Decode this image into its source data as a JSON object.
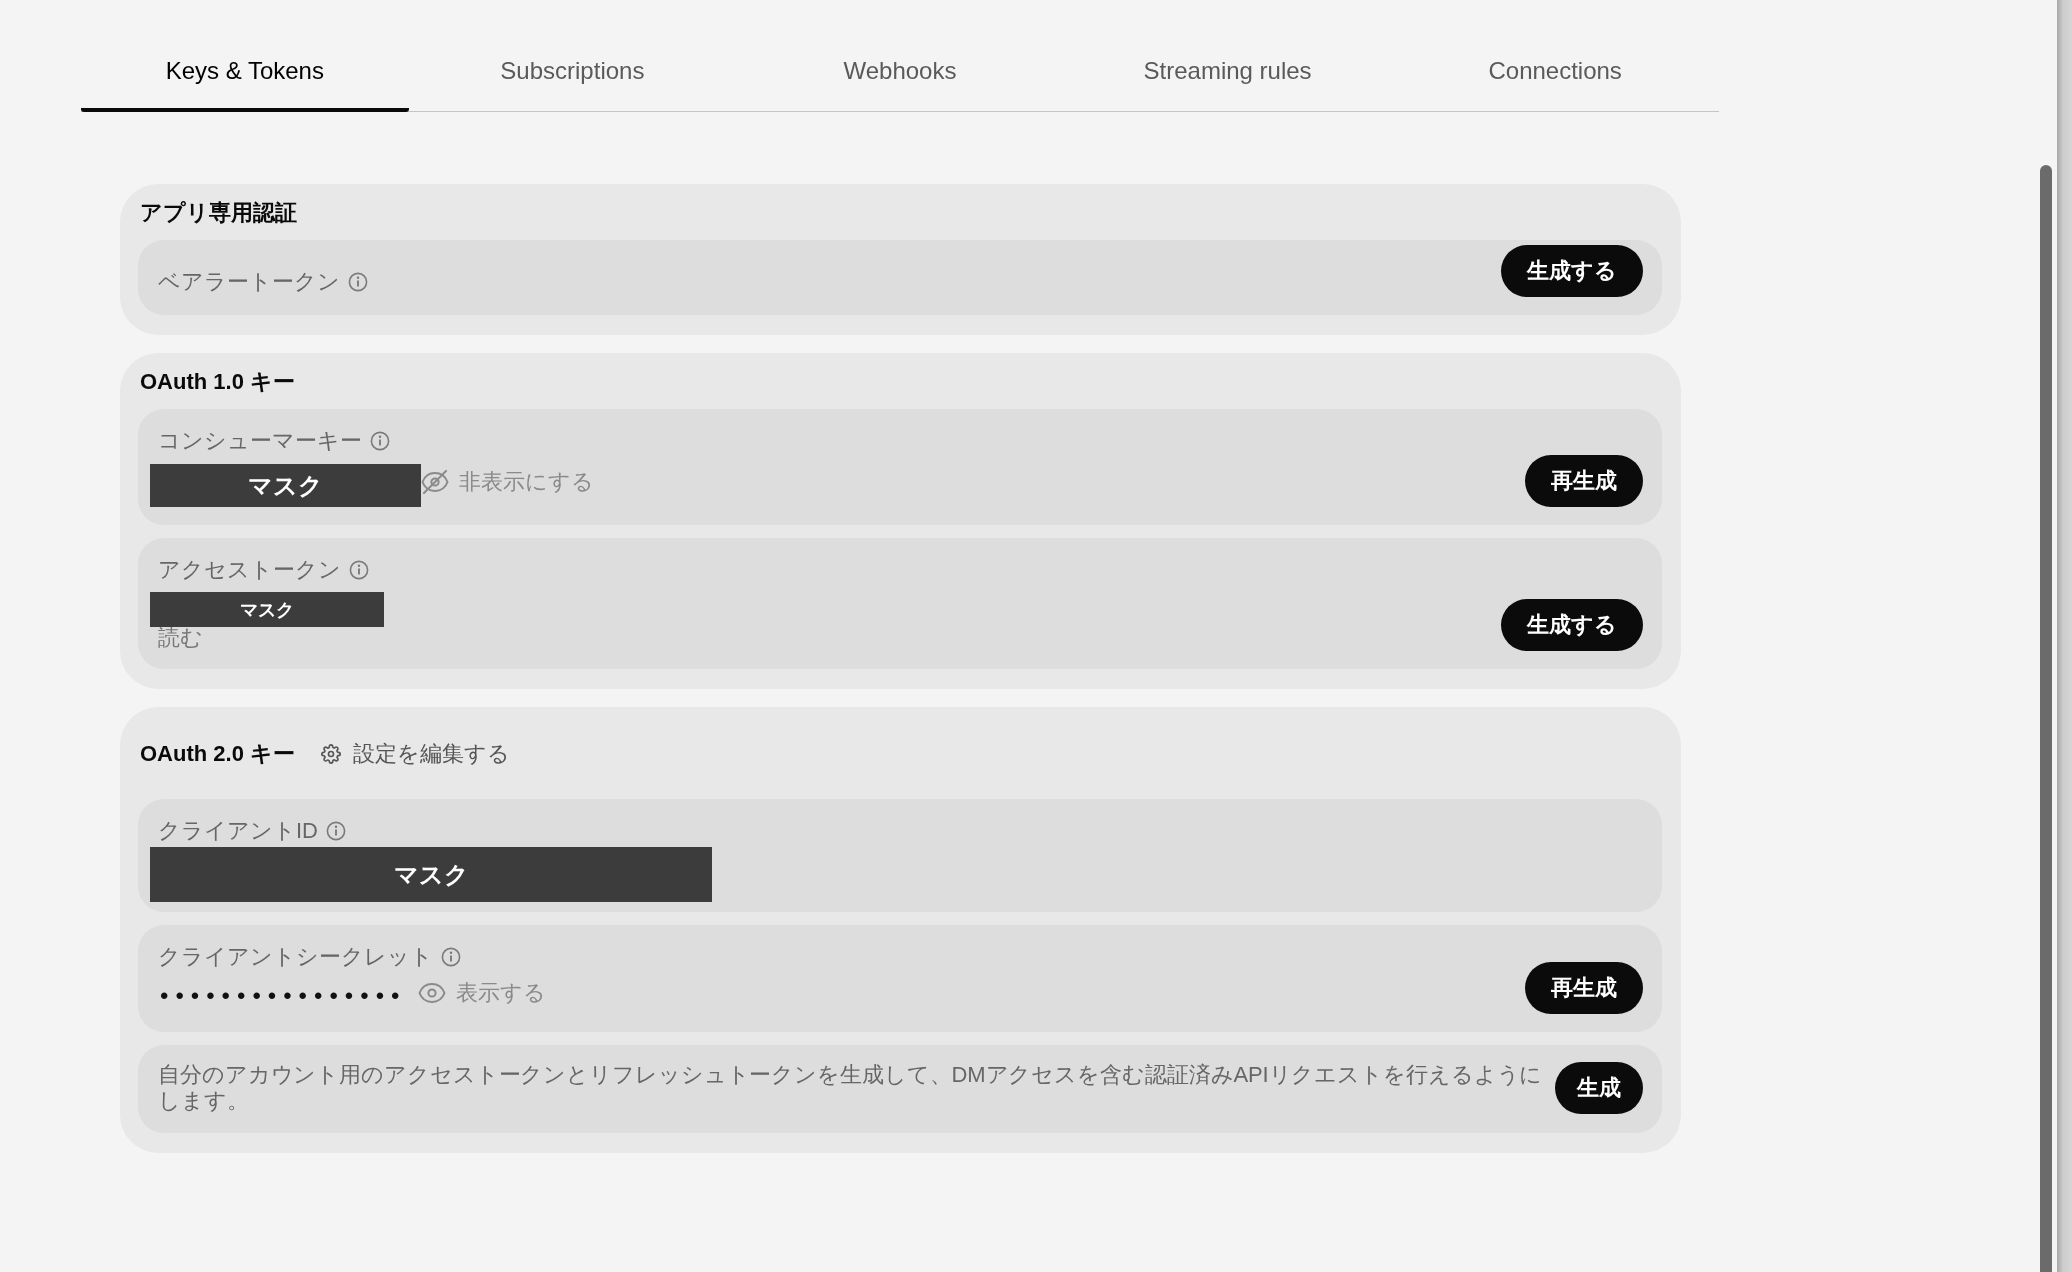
{
  "tabs": [
    {
      "label": "Keys & Tokens",
      "selected": true
    },
    {
      "label": "Subscriptions",
      "selected": false
    },
    {
      "label": "Webhooks",
      "selected": false
    },
    {
      "label": "Streaming rules",
      "selected": false
    },
    {
      "label": "Connections",
      "selected": false
    }
  ],
  "sections": [
    {
      "title": "アプリ専用認証",
      "rows": [
        {
          "kind": "credential",
          "label": "ベアラートークン",
          "button": "生成する"
        }
      ]
    },
    {
      "title": "OAuth 1.0 キー",
      "rows": [
        {
          "kind": "credential",
          "label": "コンシューマーキー",
          "mask": "マスク",
          "toggle": {
            "label": "非表示にする",
            "visible": true
          },
          "button": "再生成"
        },
        {
          "kind": "credential",
          "label": "アクセストークン",
          "mask": "マスク",
          "permission": "読む",
          "button": "生成する"
        }
      ]
    },
    {
      "title": "OAuth 2.0 キー",
      "action": "設定を編集する",
      "rows": [
        {
          "kind": "credential",
          "label": "クライアントID",
          "mask": "マスク"
        },
        {
          "kind": "credential",
          "label": "クライアントシークレット",
          "secret": "••••••••••••••••",
          "toggle": {
            "label": "表示する",
            "visible": false
          },
          "button": "再生成"
        },
        {
          "kind": "description",
          "text": "自分のアカウント用のアクセストークンとリフレッシュトークンを生成して、DMアクセスを含む認証済みAPIリクエストを行えるようにします。",
          "button": "生成"
        }
      ]
    }
  ]
}
